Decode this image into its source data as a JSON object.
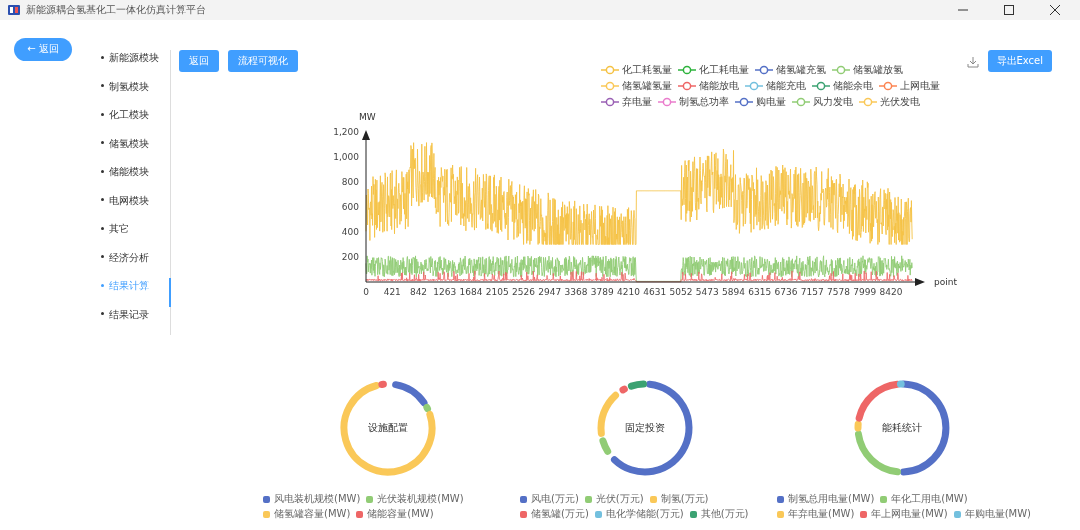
{
  "window": {
    "title": "新能源耦合氢基化工一体化仿真计算平台"
  },
  "back_button": {
    "label": "返回",
    "icon": "←"
  },
  "sidebar": {
    "items": [
      {
        "label": "新能源模块",
        "selected": false
      },
      {
        "label": "制氢模块",
        "selected": false
      },
      {
        "label": "化工模块",
        "selected": false
      },
      {
        "label": "储氢模块",
        "selected": false
      },
      {
        "label": "储能模块",
        "selected": false
      },
      {
        "label": "电网模块",
        "selected": false
      },
      {
        "label": "其它",
        "selected": false
      },
      {
        "label": "经济分析",
        "selected": false
      },
      {
        "label": "结果计算",
        "selected": true
      },
      {
        "label": "结果记录",
        "selected": false
      }
    ]
  },
  "toolbar": {
    "buttons": [
      "返回",
      "流程可视化"
    ],
    "export_button": "导出Excel"
  },
  "line_chart": {
    "y_unit": "MW",
    "x_unit": "point",
    "yticks": [
      "1,200",
      "1,000",
      "800",
      "600",
      "400",
      "200"
    ],
    "xticks": [
      "0",
      "421",
      "842",
      "1263",
      "1684",
      "2105",
      "2526",
      "2947",
      "3368",
      "3789",
      "4210",
      "4631",
      "5052",
      "5473",
      "5894",
      "6315",
      "6736",
      "7157",
      "7578",
      "7999",
      "8420"
    ],
    "legend": [
      {
        "label": "化工耗氢量",
        "color": "#f5c244"
      },
      {
        "label": "化工耗电量",
        "color": "#2db33c"
      },
      {
        "label": "储氢罐充氢",
        "color": "#5470c6"
      },
      {
        "label": "储氢罐放氢",
        "color": "#91cc75"
      },
      {
        "label": "储氢罐氢量",
        "color": "#fac858"
      },
      {
        "label": "储能放电",
        "color": "#ee6666"
      },
      {
        "label": "储能充电",
        "color": "#73c0de"
      },
      {
        "label": "储能余电",
        "color": "#3ba272"
      },
      {
        "label": "上网电量",
        "color": "#fc8452"
      },
      {
        "label": "弃电量",
        "color": "#9a60b4"
      },
      {
        "label": "制氢总功率",
        "color": "#ea7ccc"
      },
      {
        "label": "购电量",
        "color": "#5470c6"
      },
      {
        "label": "风力发电",
        "color": "#91cc75"
      },
      {
        "label": "光伏发电",
        "color": "#fac858"
      }
    ]
  },
  "donuts": [
    {
      "title": "设施配置",
      "legend": [
        {
          "label": "风电装机规模(MW)",
          "color": "#5470c6"
        },
        {
          "label": "光伏装机规模(MW)",
          "color": "#91cc75"
        },
        {
          "label": "储氢罐容量(MW)",
          "color": "#fac858"
        },
        {
          "label": "储能容量(MW)",
          "color": "#ee6666"
        }
      ]
    },
    {
      "title": "固定投资",
      "legend": [
        {
          "label": "风电(万元)",
          "color": "#5470c6"
        },
        {
          "label": "光伏(万元)",
          "color": "#91cc75"
        },
        {
          "label": "制氢(万元)",
          "color": "#fac858"
        },
        {
          "label": "储氢罐(万元)",
          "color": "#ee6666"
        },
        {
          "label": "电化学储能(万元)",
          "color": "#73c0de"
        },
        {
          "label": "其他(万元)",
          "color": "#3ba272"
        }
      ]
    },
    {
      "title": "能耗统计",
      "legend": [
        {
          "label": "制氢总用电量(MW)",
          "color": "#5470c6"
        },
        {
          "label": "年化工用电(MW)",
          "color": "#91cc75"
        },
        {
          "label": "年弃电量(MW)",
          "color": "#fac858"
        },
        {
          "label": "年上网电量(MW)",
          "color": "#ee6666"
        },
        {
          "label": "年购电量(MW)",
          "color": "#73c0de"
        }
      ]
    }
  ]
}
